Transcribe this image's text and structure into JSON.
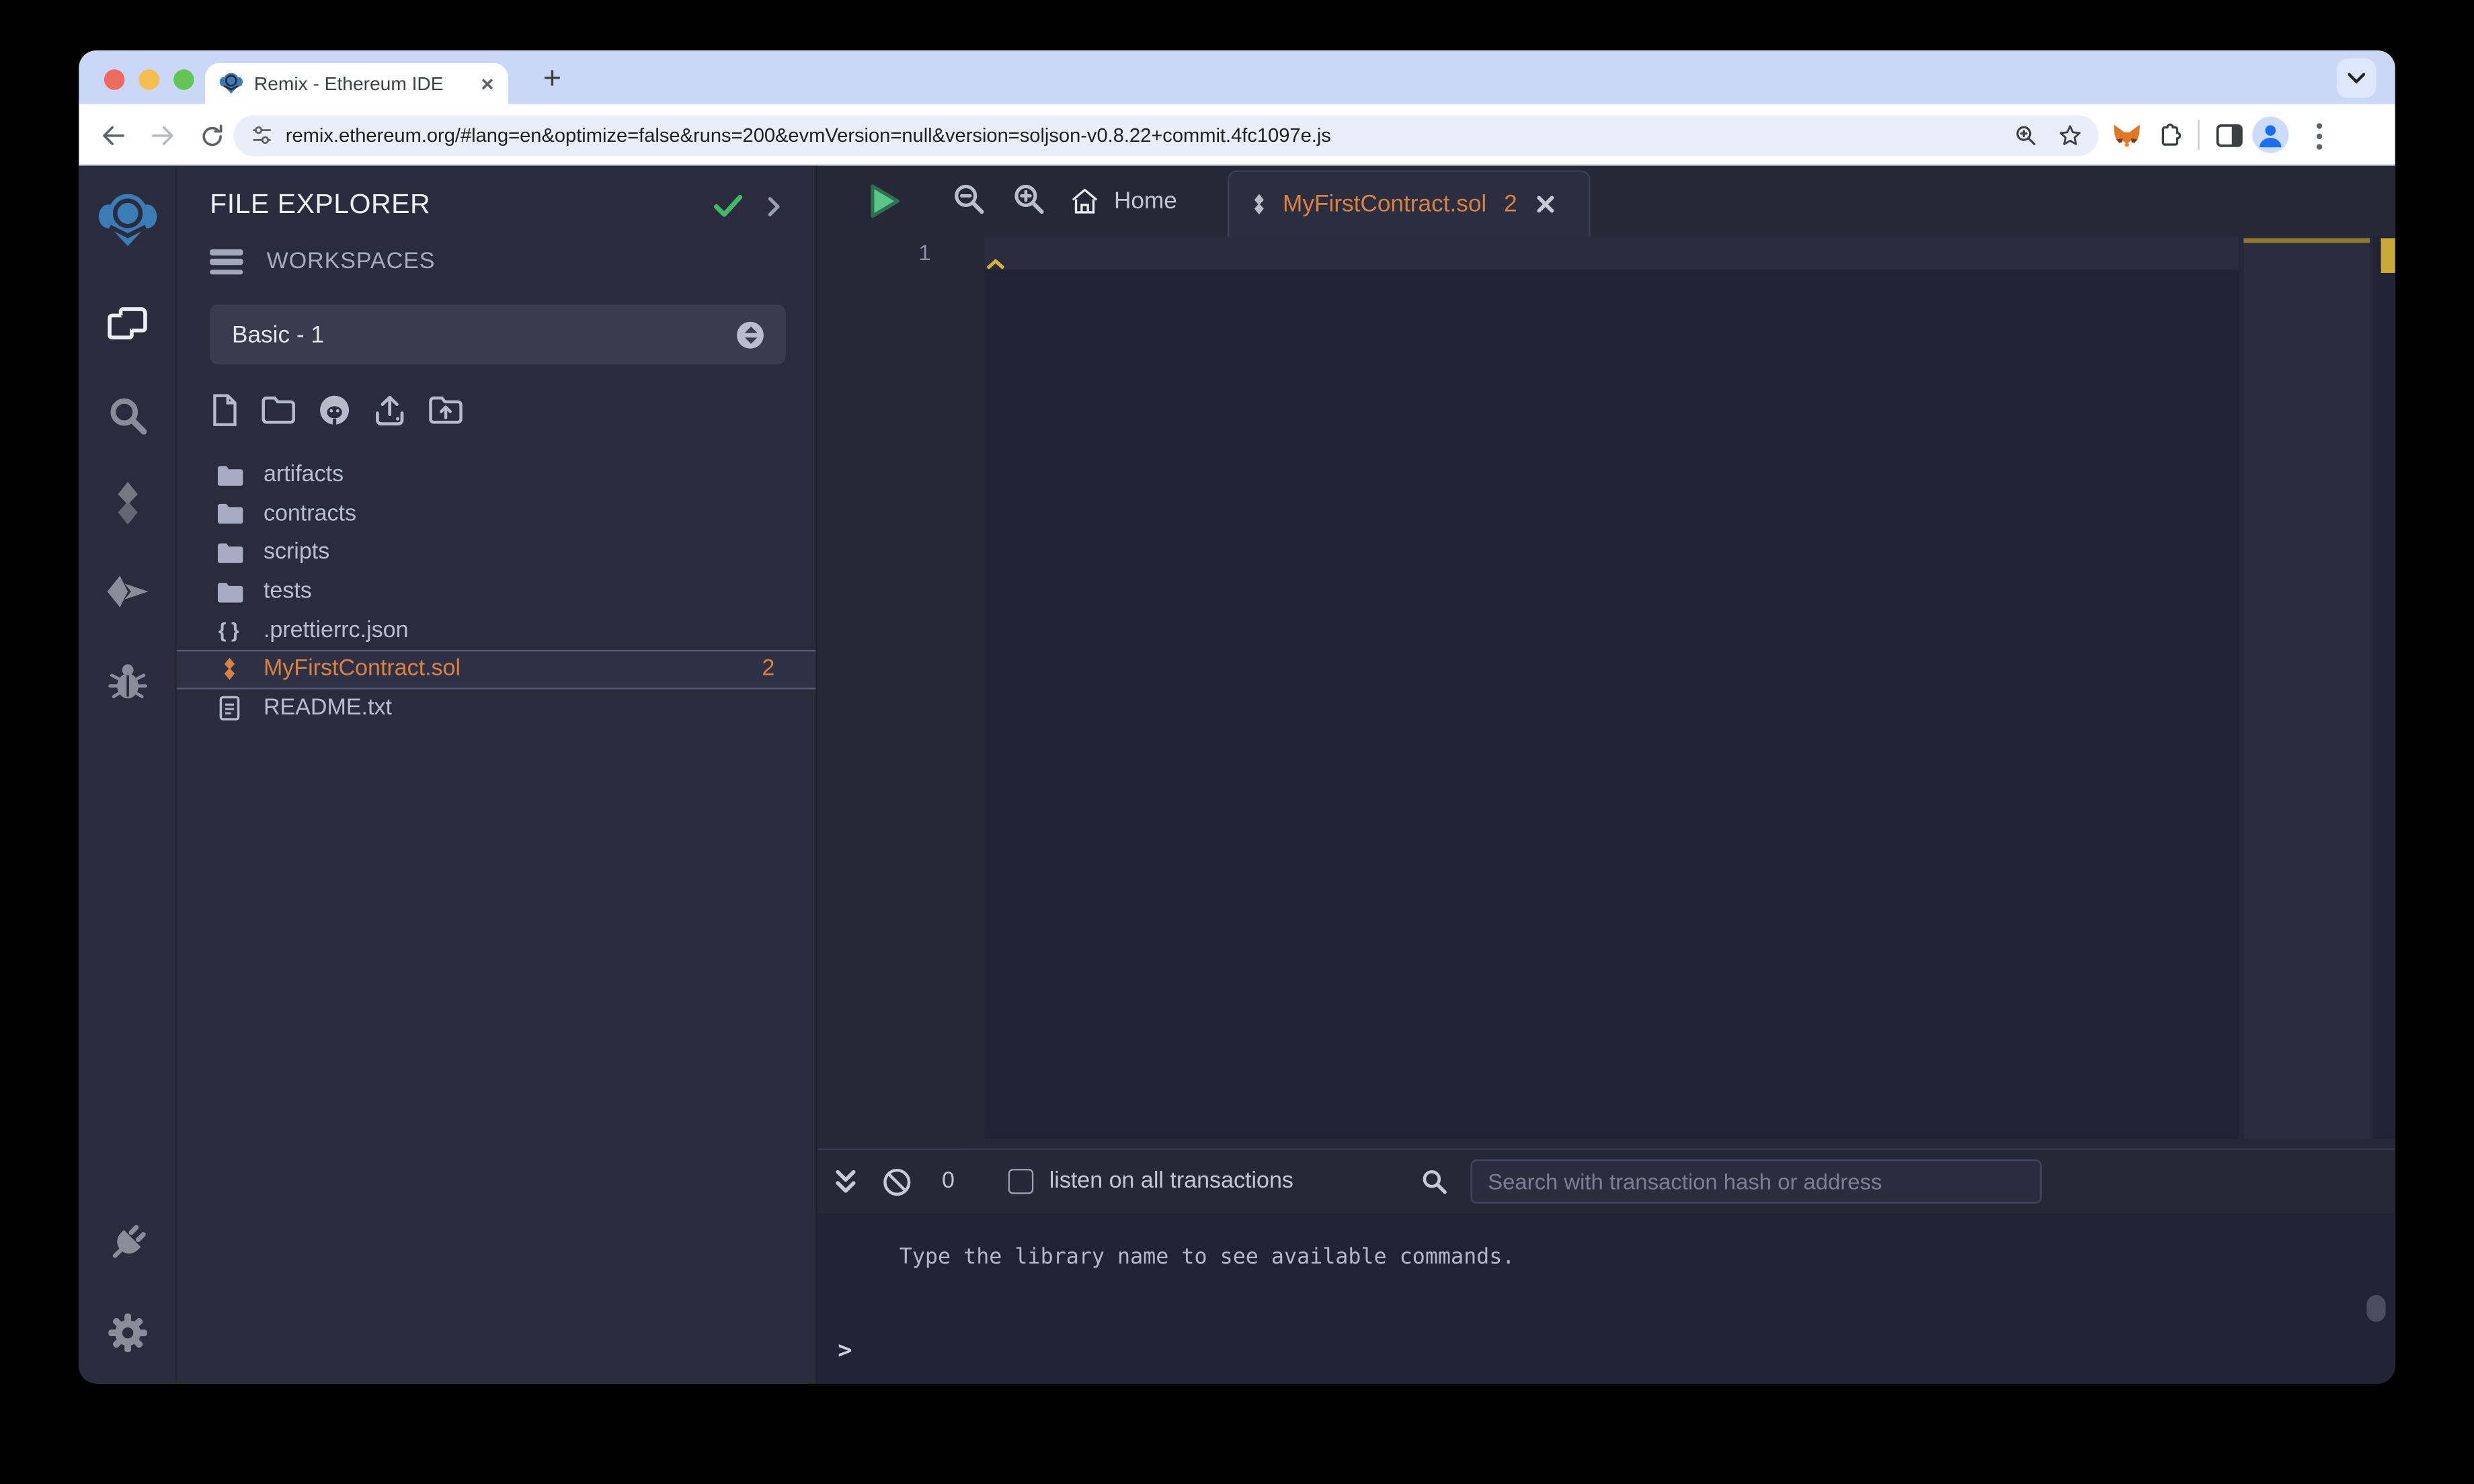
{
  "colors": {
    "accent_orange": "#d9823f",
    "remix_blue": "#3a7cb6",
    "success_green": "#3fba63",
    "warning_yellow": "#d4b13e",
    "run_green": "#59c689",
    "chrome_tabstrip": "#cbd7f6",
    "panel_bg": "#2a2c3e",
    "editor_bg": "#212233"
  },
  "browser": {
    "tab_title": "Remix - Ethereum IDE",
    "url": "remix.ethereum.org/#lang=en&optimize=false&runs=200&evmVersion=null&version=soljson-v0.8.22+commit.4fc1097e.js",
    "new_tab_label": "+",
    "toolbar_icons": [
      "back",
      "forward",
      "reload",
      "site-controls",
      "zoom",
      "bookmark-star",
      "metamask",
      "extensions",
      "side-panel",
      "profile",
      "menu"
    ]
  },
  "rail_icons": [
    "remix-logo",
    "file-explorer",
    "search",
    "solidity-compiler",
    "deploy-and-run",
    "debugger",
    "plugin-manager",
    "settings"
  ],
  "explorer": {
    "title": "FILE EXPLORER",
    "workspaces_label": "WORKSPACES",
    "workspace_selected": "Basic - 1",
    "toolbar_icons": [
      "new-file",
      "new-folder",
      "clone-github",
      "upload-file",
      "upload-folder"
    ],
    "tree": [
      {
        "label": "artifacts",
        "type": "folder"
      },
      {
        "label": "contracts",
        "type": "folder"
      },
      {
        "label": "scripts",
        "type": "folder"
      },
      {
        "label": "tests",
        "type": "folder"
      },
      {
        "label": ".prettierrc.json",
        "type": "json"
      },
      {
        "label": "MyFirstContract.sol",
        "type": "solidity",
        "badge": "2",
        "selected": true
      },
      {
        "label": "README.txt",
        "type": "text"
      }
    ]
  },
  "editor": {
    "toolbar_icons": [
      "run-script",
      "zoom-out",
      "zoom-in"
    ],
    "tabs": [
      {
        "label": "Home",
        "active": false
      },
      {
        "label": "MyFirstContract.sol",
        "badge": "2",
        "active": true
      }
    ],
    "line_numbers": [
      "1"
    ]
  },
  "terminal": {
    "pending_count": "0",
    "listen_label": "listen on all transactions",
    "search_placeholder": "Search with transaction hash or address",
    "message": "Type the library name to see available commands.",
    "prompt": ">"
  }
}
